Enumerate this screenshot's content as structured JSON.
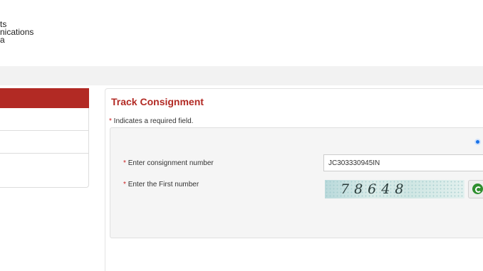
{
  "header": {
    "line1": "ts",
    "line2": "nications",
    "line3": "a"
  },
  "panel": {
    "title": "Track Consignment",
    "required_note_star": "*",
    "required_note_text": " Indicates a required field."
  },
  "form": {
    "consignment_label": "Enter consignment number",
    "consignment_value": "JC303330945IN",
    "first_number_label": "Enter the First number",
    "captcha_text": "78648",
    "required_star": "*"
  },
  "colors": {
    "accent": "#b22a24",
    "radio": "#1a73e8"
  },
  "icons": {
    "refresh": "refresh-icon",
    "radio": "radio-selected-icon"
  }
}
